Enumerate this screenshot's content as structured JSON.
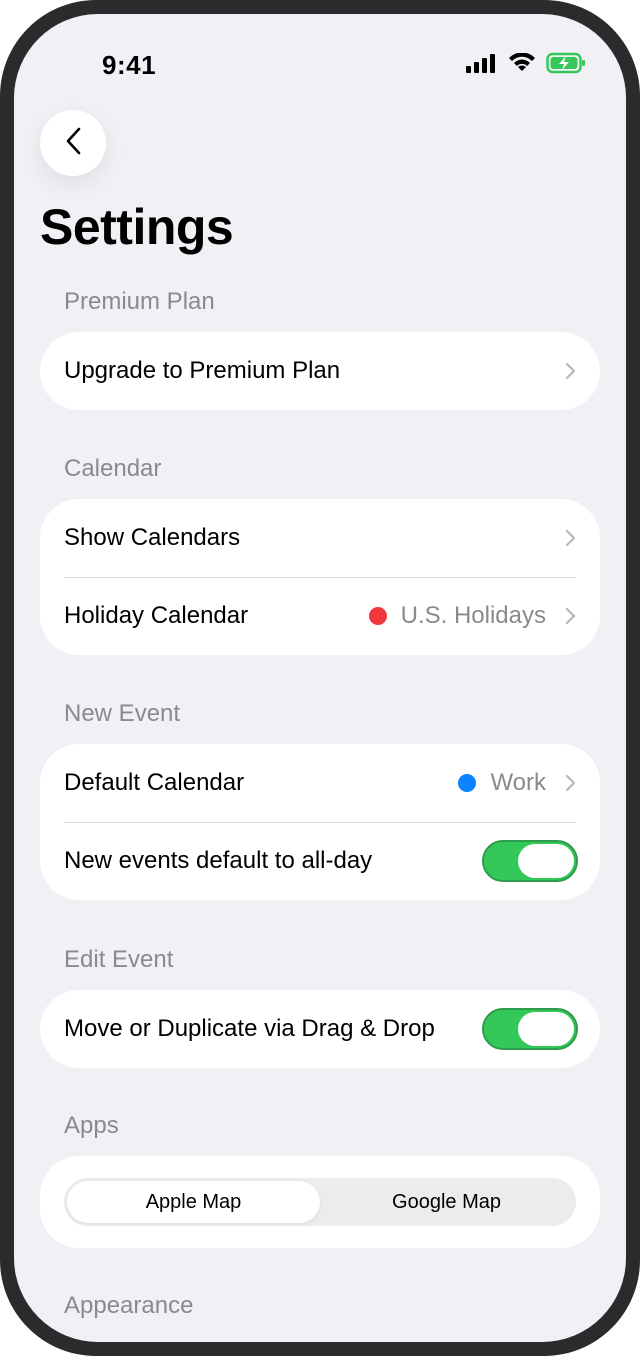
{
  "status": {
    "time": "9:41",
    "icons": [
      "cellular-icon",
      "wifi-icon",
      "battery-charging-icon"
    ],
    "battery_color": "#34c759"
  },
  "header": {
    "back_icon": "chevron-left-icon",
    "title": "Settings"
  },
  "sections": {
    "premium": {
      "header": "Premium Plan",
      "upgrade_label": "Upgrade to Premium Plan"
    },
    "calendar": {
      "header": "Calendar",
      "show_calendars_label": "Show Calendars",
      "holiday_label": "Holiday Calendar",
      "holiday_value": "U.S. Holidays",
      "holiday_color": "#f2383d"
    },
    "new_event": {
      "header": "New Event",
      "default_calendar_label": "Default Calendar",
      "default_calendar_value": "Work",
      "default_calendar_color": "#0a84ff",
      "all_day_label": "New events default to all-day",
      "all_day_on": true
    },
    "edit_event": {
      "header": "Edit Event",
      "drag_drop_label": "Move or Duplicate via Drag & Drop",
      "drag_drop_on": true
    },
    "apps": {
      "header": "Apps",
      "options": [
        "Apple Map",
        "Google Map"
      ],
      "selected": "Apple Map"
    },
    "appearance": {
      "header": "Appearance"
    }
  },
  "colors": {
    "background": "#f1f1f5",
    "toggle_on": "#34c759",
    "secondary_text": "#8a8a8e"
  }
}
